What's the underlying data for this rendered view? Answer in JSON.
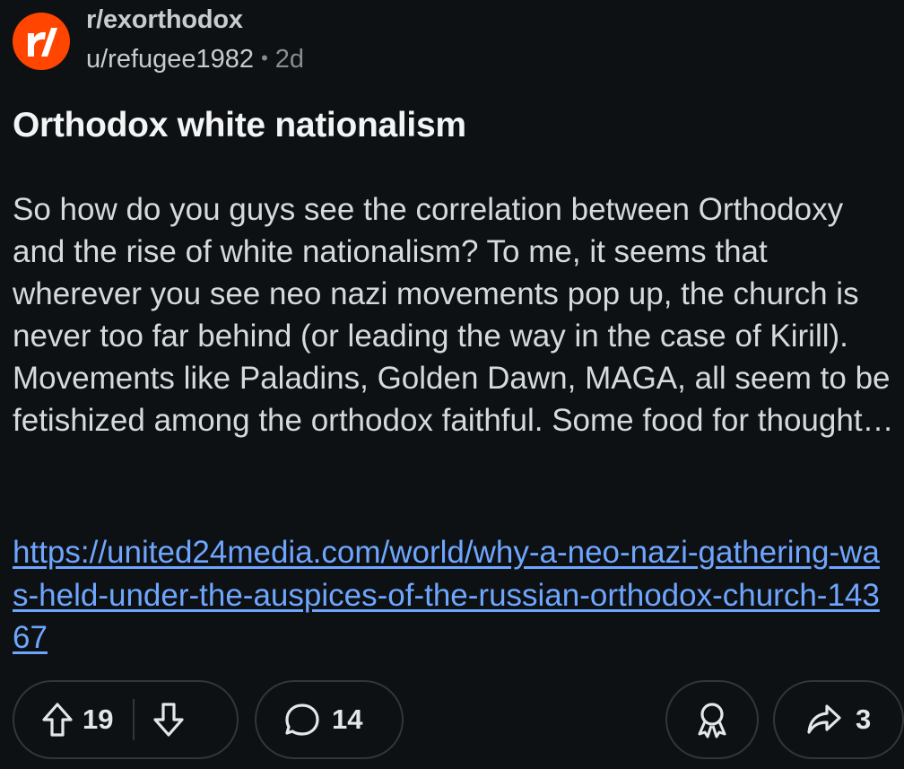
{
  "post": {
    "subreddit": "r/exorthodox",
    "author": "u/refugee1982",
    "separator": "•",
    "age": "2d",
    "title": "Orthodox white nationalism",
    "body": "So how do you guys see the correlation between Orthodoxy and the rise of white nationalism? To me, it seems that wherever you see neo nazi movements pop up, the church is never too far behind (or leading the way in the case of Kirill). Movements like Paladins, Golden Dawn, MAGA, all seem to be fetishized among the orthodox faithful. Some food for thought…",
    "link": "https://united24media.com/world/why-a-neo-nazi-gathering-was-held-under-the-auspices-of-the-russian-orthodox-church-14367"
  },
  "actions": {
    "upvotes": "19",
    "comments": "14",
    "shares": "3"
  },
  "colors": {
    "background": "#0e1113",
    "accent": "#ff4500",
    "link": "#6ea6ff",
    "border": "#343536"
  },
  "icons": [
    "subreddit-avatar-icon",
    "upvote-icon",
    "downvote-icon",
    "comment-icon",
    "award-icon",
    "share-icon"
  ]
}
